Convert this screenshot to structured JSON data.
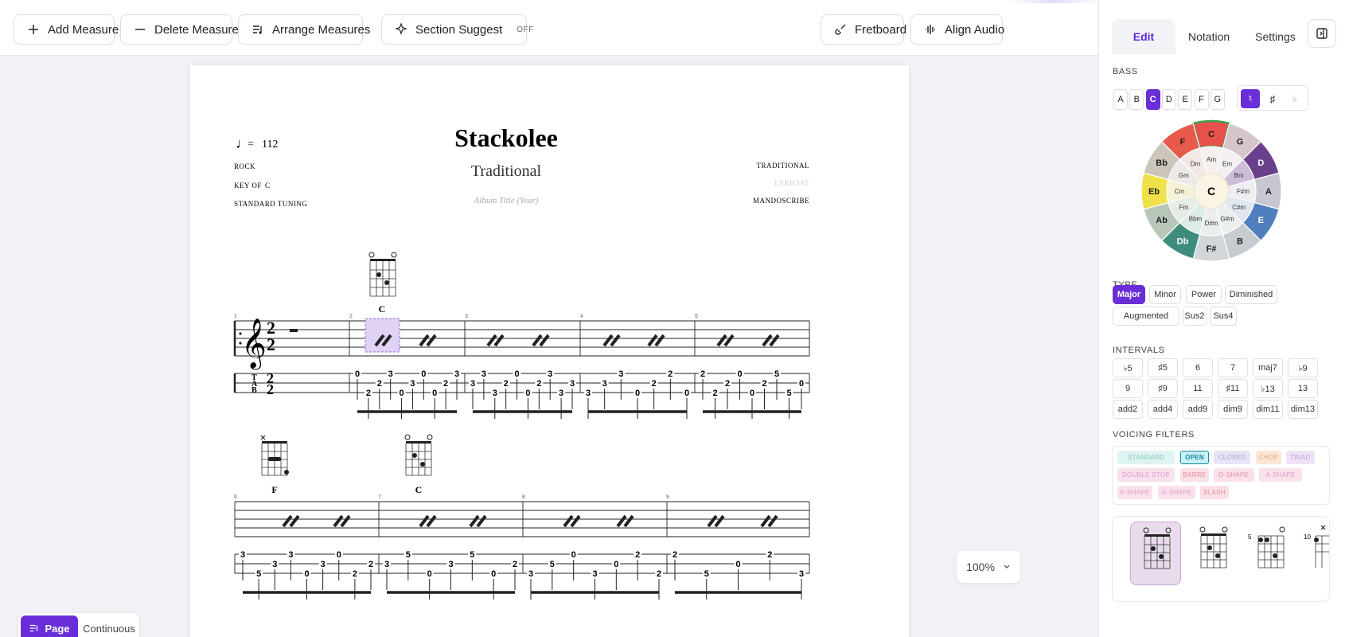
{
  "toolbar": {
    "add_measure": "Add Measure",
    "delete_measure": "Delete Measure",
    "arrange_measures": "Arrange Measures",
    "section_suggest": "Section Suggest",
    "section_suggest_state": "OFF",
    "fretboard": "Fretboard",
    "align_audio": "Align Audio"
  },
  "score": {
    "tempo_symbol": "♩",
    "tempo_eq": "=",
    "tempo": "112",
    "title": "Stackolee",
    "subtitle": "Traditional",
    "album": "Album Title (Year)",
    "genre": "ROCK",
    "key_label": "KEY OF",
    "key": "C",
    "tuning": "STANDARD TUNING",
    "composer": "TRADITIONAL",
    "lyricist": "LYRICIST",
    "transcriber": "MANDOSCRIBE",
    "time_sig_top": "2",
    "time_sig_bottom": "2",
    "tab_letters": [
      "T",
      "A",
      "B"
    ],
    "measure_numbers": [
      "1",
      "2",
      "3",
      "4",
      "5",
      "6",
      "7",
      "8",
      "9"
    ],
    "chords": [
      "C",
      "F",
      "C"
    ]
  },
  "tab_row1": [
    {
      "m": "m2",
      "frets": [
        "0",
        "2",
        "2",
        "3",
        "0",
        "3",
        "0",
        "0",
        "2",
        "3"
      ]
    },
    {
      "m": "m3",
      "frets": [
        "3",
        "3",
        "3",
        "2",
        "0",
        "0",
        "2",
        "3",
        "3",
        "3"
      ]
    },
    {
      "m": "m4",
      "frets": [
        "3",
        "3",
        "3",
        "0",
        "2",
        "2",
        "0"
      ]
    },
    {
      "m": "m5",
      "frets": [
        "2",
        "2",
        "2",
        "0",
        "0",
        "2",
        "5",
        "5",
        "0"
      ]
    }
  ],
  "tab_row2": [
    {
      "m": "m6",
      "frets": [
        "3",
        "5",
        "3",
        "3",
        "0",
        "3",
        "0",
        "2",
        "2"
      ]
    },
    {
      "m": "m7",
      "frets": [
        "3",
        "5",
        "0",
        "3",
        "5",
        "0",
        "2"
      ]
    },
    {
      "m": "m8",
      "frets": [
        "3",
        "5",
        "0",
        "3",
        "0",
        "2",
        "2"
      ]
    },
    {
      "m": "m9",
      "frets": [
        "2",
        "5",
        "0",
        "2",
        "3"
      ]
    }
  ],
  "sidebar": {
    "tabs": [
      "Edit",
      "Notation",
      "Settings"
    ],
    "bass_label": "BASS",
    "bass_notes": [
      "A",
      "B",
      "C",
      "D",
      "E",
      "F",
      "G"
    ],
    "bass_selected": "C",
    "accidentals": [
      "♮",
      "♯",
      "♭"
    ],
    "circle_center": "C",
    "circle_outer": [
      "C",
      "G",
      "D",
      "A",
      "E",
      "B",
      "F#",
      "Db",
      "Ab",
      "Eb",
      "Bb",
      "F"
    ],
    "circle_inner": [
      "Am",
      "Em",
      "Bm",
      "F#m",
      "C#m",
      "G#m",
      "D#m",
      "Bbm",
      "Fm",
      "Cm",
      "Gm",
      "Dm"
    ],
    "type_label": "TYPE",
    "types": [
      "Major",
      "Minor",
      "Power",
      "Diminished",
      "Augmented",
      "Sus2",
      "Sus4"
    ],
    "type_selected": "Major",
    "intervals_label": "INTERVALS",
    "intervals": [
      "♭5",
      "♯5",
      "6",
      "7",
      "maj7",
      "♭9",
      "9",
      "♯9",
      "11",
      "♯11",
      "♭13",
      "13",
      "add2",
      "add4",
      "add9",
      "dim9",
      "dim11",
      "dim13"
    ],
    "voicing_label": "VOICING FILTERS",
    "voicing_filters": [
      "STANDARD",
      "OPEN",
      "CLOSED",
      "CHOP",
      "TRIAD",
      "DOUBLE STOP",
      "BARRE",
      "D-SHAPE",
      "A-SHAPE",
      "E-SHAPE",
      "G-SHAPE",
      "SLASH"
    ],
    "voicing_selected": "OPEN",
    "voicing_fret_labels": [
      "5",
      "10"
    ]
  },
  "view": {
    "page": "Page",
    "continuous": "Continuous"
  },
  "zoom": {
    "level": "100%"
  },
  "colors": {
    "accent": "#6a2ed8"
  }
}
